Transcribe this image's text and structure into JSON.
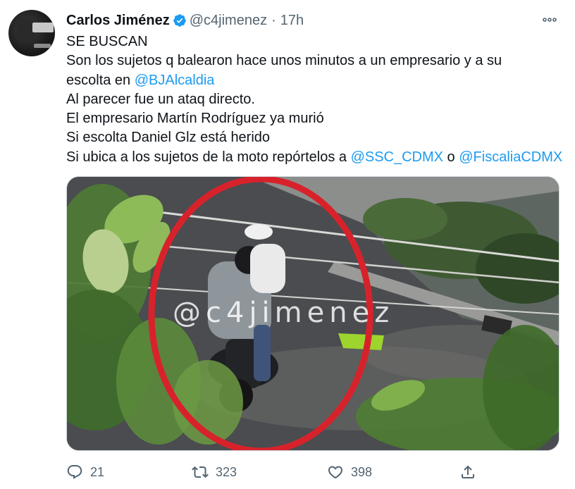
{
  "colors": {
    "accent": "#1d9bf0",
    "text": "#0f1419",
    "secondary": "#536471",
    "circle": "#d8222b"
  },
  "author": {
    "display_name": "Carlos Jiménez",
    "handle": "@c4jimenez",
    "separator": "·",
    "time": "17h",
    "verified_icon": "verified-badge-icon"
  },
  "tweet": {
    "lines": [
      {
        "text": "SE BUSCAN"
      },
      {
        "text": "Son los sujetos q  balearon hace unos minutos a un empresario y a su"
      },
      {
        "text": "escolta en ",
        "mention": "@BJAlcaldia"
      },
      {
        "text": "Al parecer fue un ataq directo."
      },
      {
        "text": "El empresario Martín Rodríguez ya murió"
      },
      {
        "text": "Si escolta Daniel Glz está herido"
      },
      {
        "text": "Si ubica a los sujetos de la moto repórtelos a ",
        "mention": "@SSC_CDMX",
        "between": " o ",
        "mention2": "@FiscaliaCDMX"
      }
    ]
  },
  "media": {
    "watermark": "@c4jimenez"
  },
  "actions": {
    "reply": {
      "icon": "reply-icon",
      "count": "21"
    },
    "retweet": {
      "icon": "retweet-icon",
      "count": "323"
    },
    "like": {
      "icon": "heart-icon",
      "count": "398"
    },
    "share": {
      "icon": "share-icon"
    }
  },
  "more_icon": "more-options-icon"
}
